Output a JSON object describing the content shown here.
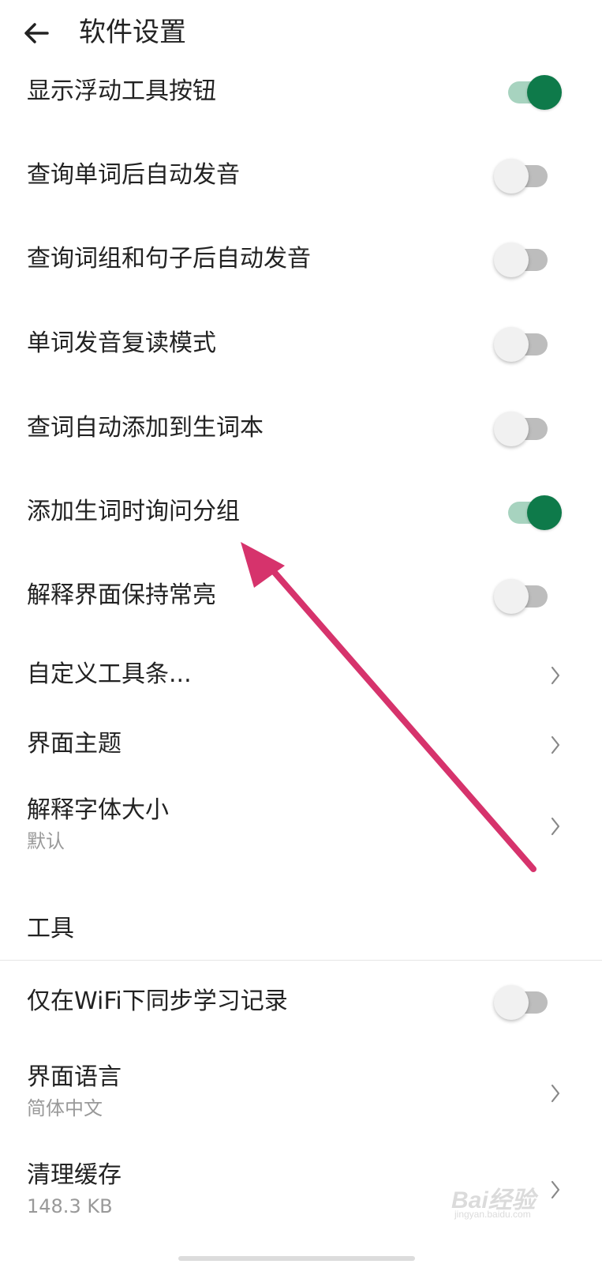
{
  "header": {
    "title": "软件设置"
  },
  "settings": [
    {
      "label": "显示浮动工具按钮",
      "toggle": true
    },
    {
      "label": "查询单词后自动发音",
      "toggle": false
    },
    {
      "label": "查询词组和句子后自动发音",
      "toggle": false
    },
    {
      "label": "单词发音复读模式",
      "toggle": false
    },
    {
      "label": "查词自动添加到生词本",
      "toggle": false
    },
    {
      "label": "添加生词时询问分组",
      "toggle": true
    },
    {
      "label": "解释界面保持常亮",
      "toggle": false
    },
    {
      "label": "自定义工具条..."
    },
    {
      "label": "界面主题"
    },
    {
      "label": "解释字体大小",
      "sub": "默认"
    }
  ],
  "tools_section": {
    "title": "工具",
    "items": [
      {
        "label": "仅在WiFi下同步学习记录",
        "toggle": false
      },
      {
        "label": "界面语言",
        "sub": "简体中文"
      },
      {
        "label": "清理缓存",
        "sub": "148.3 KB"
      }
    ]
  },
  "colors": {
    "toggle_on": "#0e7a4a",
    "toggle_on_track": "#a7d3bf",
    "annotation_arrow": "#d6336c"
  },
  "watermark": {
    "brand": "Bai经验",
    "url": "jingyan.baidu.com"
  }
}
